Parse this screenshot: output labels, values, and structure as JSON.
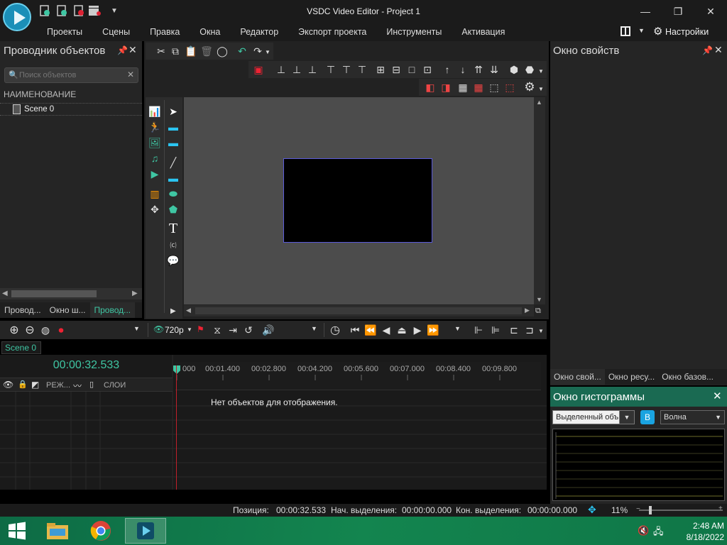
{
  "window": {
    "title": "VSDC Video Editor - Project 1",
    "menu": [
      "Проекты",
      "Сцены",
      "Правка",
      "Окна",
      "Редактор",
      "Экспорт проекта",
      "Инструменты",
      "Активация"
    ],
    "settings_label": "Настройки"
  },
  "left_panel": {
    "title": "Проводник объектов",
    "search_placeholder": "Поиск объектов",
    "column_header": "НАИМЕНОВАНИЕ",
    "scene_item": "Scene 0",
    "tabs": [
      "Провод...",
      "Окно ш...",
      "Провод..."
    ]
  },
  "right_panel": {
    "title": "Окно свойств",
    "tabs": [
      "Окно свой...",
      "Окно ресу...",
      "Окно базов..."
    ]
  },
  "histogram": {
    "title": "Окно гистограммы",
    "selection": "Выделенный объ",
    "badge": "B",
    "mode": "Волна"
  },
  "timeline": {
    "resolution": "720p",
    "scene_tab": "Scene 0",
    "timecode": "00:00:32.533",
    "ruler_ticks": [
      "000",
      "00:01.400",
      "00:02.800",
      "00:04.200",
      "00:05.600",
      "00:07.000",
      "00:08.400",
      "00:09.800"
    ],
    "layer_mode_label": "РЕЖ...",
    "layers_label": "СЛОИ",
    "empty_message": "Нет объектов для отображения."
  },
  "status": {
    "position_label": "Позиция:",
    "position_value": "00:00:32.533",
    "sel_start_label": "Нач. выделения:",
    "sel_start_value": "00:00:00.000",
    "sel_end_label": "Кон. выделения:",
    "sel_end_value": "00:00:00.000",
    "zoom": "11%"
  },
  "taskbar": {
    "time": "2:48 AM",
    "date": "8/18/2022"
  },
  "colors": {
    "accent": "#3fc6a3",
    "histogram_title_bg": "#1a6a52",
    "taskbar": "#13854f"
  }
}
